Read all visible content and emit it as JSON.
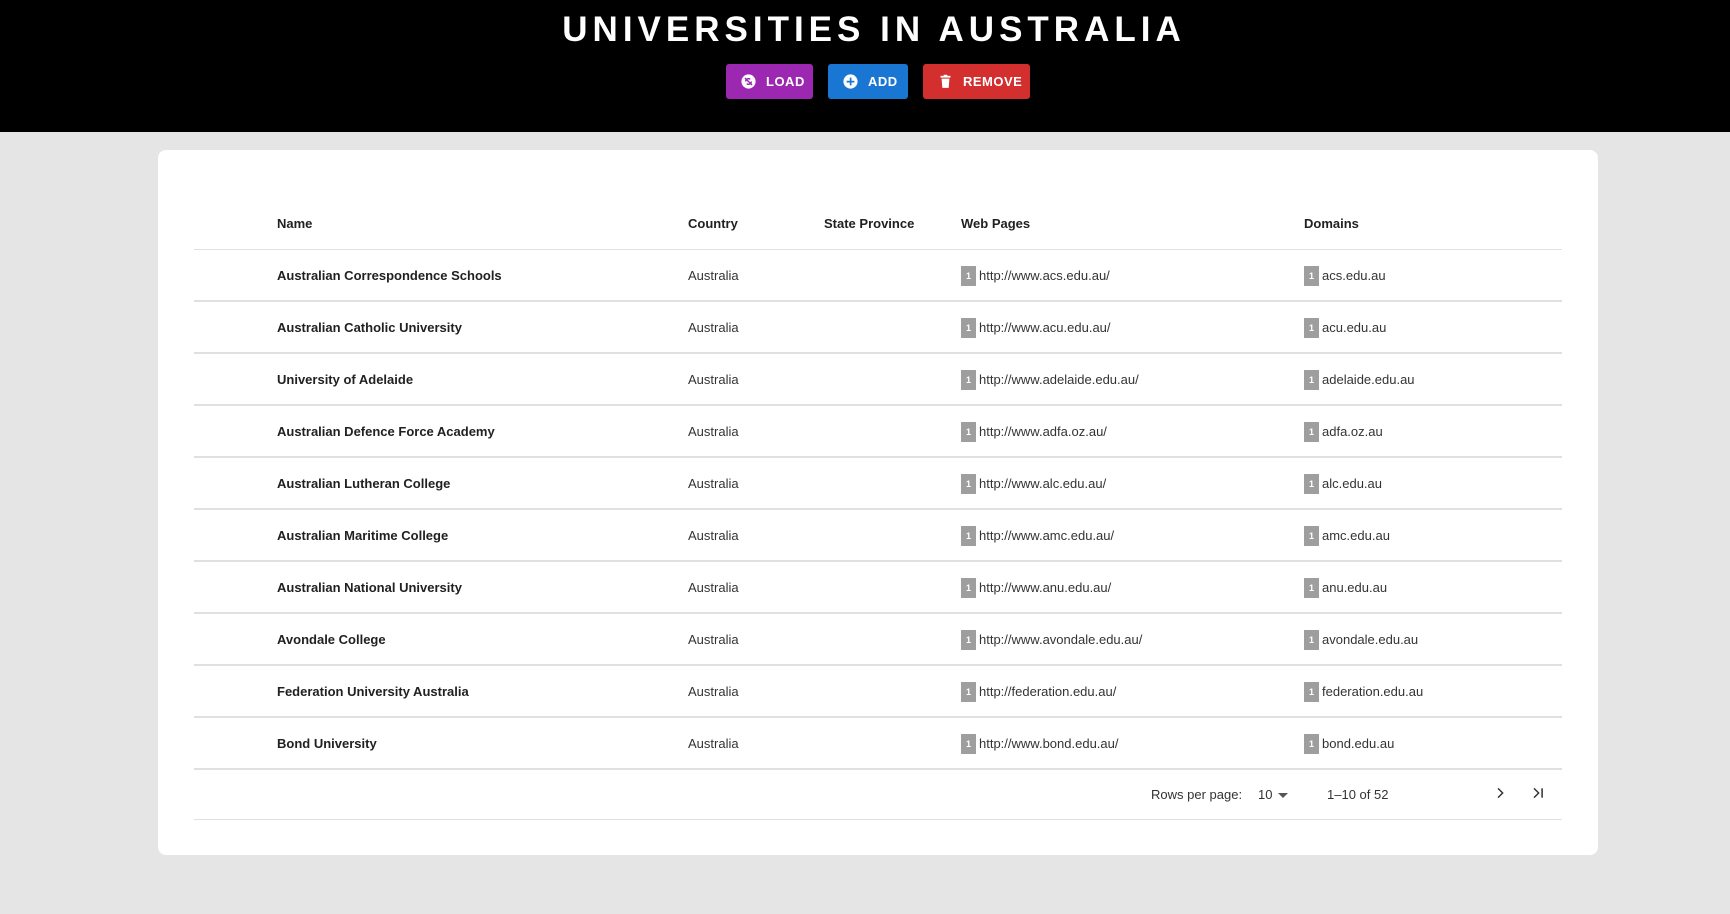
{
  "header": {
    "title": "UNIVERSITIES IN AUSTRALIA",
    "buttons": {
      "load": "LOAD",
      "add": "ADD",
      "remove": "REMOVE"
    },
    "colors": {
      "load": "#9c27b0",
      "add": "#1976d2",
      "remove": "#d32f2f"
    }
  },
  "table": {
    "columns": [
      "Name",
      "Country",
      "State Province",
      "Web Pages",
      "Domains"
    ],
    "rows": [
      {
        "name": "Australian Correspondence Schools",
        "country": "Australia",
        "state": "",
        "web_count": "1",
        "web": "http://www.acs.edu.au/",
        "domain_count": "1",
        "domain": "acs.edu.au"
      },
      {
        "name": "Australian Catholic University",
        "country": "Australia",
        "state": "",
        "web_count": "1",
        "web": "http://www.acu.edu.au/",
        "domain_count": "1",
        "domain": "acu.edu.au"
      },
      {
        "name": "University of Adelaide",
        "country": "Australia",
        "state": "",
        "web_count": "1",
        "web": "http://www.adelaide.edu.au/",
        "domain_count": "1",
        "domain": "adelaide.edu.au"
      },
      {
        "name": "Australian Defence Force Academy",
        "country": "Australia",
        "state": "",
        "web_count": "1",
        "web": "http://www.adfa.oz.au/",
        "domain_count": "1",
        "domain": "adfa.oz.au"
      },
      {
        "name": "Australian Lutheran College",
        "country": "Australia",
        "state": "",
        "web_count": "1",
        "web": "http://www.alc.edu.au/",
        "domain_count": "1",
        "domain": "alc.edu.au"
      },
      {
        "name": "Australian Maritime College",
        "country": "Australia",
        "state": "",
        "web_count": "1",
        "web": "http://www.amc.edu.au/",
        "domain_count": "1",
        "domain": "amc.edu.au"
      },
      {
        "name": "Australian National University",
        "country": "Australia",
        "state": "",
        "web_count": "1",
        "web": "http://www.anu.edu.au/",
        "domain_count": "1",
        "domain": "anu.edu.au"
      },
      {
        "name": "Avondale College",
        "country": "Australia",
        "state": "",
        "web_count": "1",
        "web": "http://www.avondale.edu.au/",
        "domain_count": "1",
        "domain": "avondale.edu.au"
      },
      {
        "name": "Federation University Australia",
        "country": "Australia",
        "state": "",
        "web_count": "1",
        "web": "http://federation.edu.au/",
        "domain_count": "1",
        "domain": "federation.edu.au"
      },
      {
        "name": "Bond University",
        "country": "Australia",
        "state": "",
        "web_count": "1",
        "web": "http://www.bond.edu.au/",
        "domain_count": "1",
        "domain": "bond.edu.au"
      }
    ]
  },
  "pagination": {
    "rows_per_page_label": "Rows per page:",
    "rows_per_page_value": "10",
    "range": "1–10 of 52",
    "icons": {
      "next": "chevron-right-icon",
      "last": "last-page-icon"
    }
  }
}
